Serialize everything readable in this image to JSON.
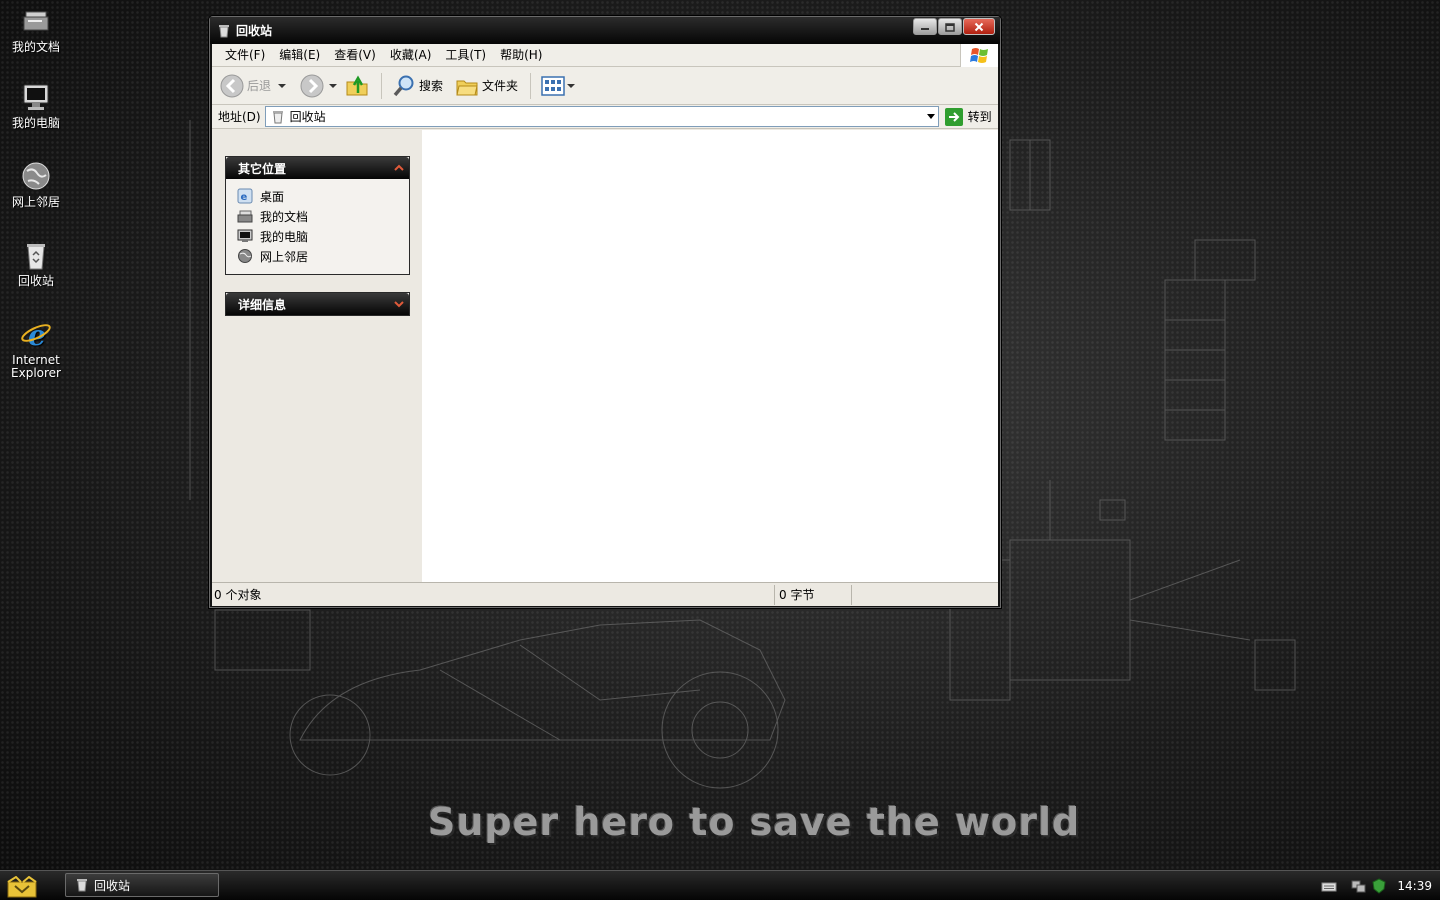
{
  "desktop": {
    "icons": [
      {
        "label": "我的文档",
        "icon": "my-documents-icon"
      },
      {
        "label": "我的电脑",
        "icon": "computer-icon"
      },
      {
        "label": "网上邻居",
        "icon": "network-globe-icon"
      },
      {
        "label": "回收站",
        "icon": "recycle-bin-icon"
      },
      {
        "label": "Internet Explorer",
        "icon": "internet-explorer-icon"
      }
    ],
    "wallpaper_text": "Super hero to save the world"
  },
  "window": {
    "title": "回收站",
    "menu": [
      "文件(F)",
      "编辑(E)",
      "查看(V)",
      "收藏(A)",
      "工具(T)",
      "帮助(H)"
    ],
    "toolbar": {
      "back": "后退",
      "search": "搜索",
      "folders": "文件夹"
    },
    "address": {
      "label": "地址(D)",
      "value": "回收站",
      "go": "转到"
    },
    "taskpane": {
      "other_places": {
        "title": "其它位置",
        "links": [
          "桌面",
          "我的文档",
          "我的电脑",
          "网上邻居"
        ]
      },
      "details": {
        "title": "详细信息"
      }
    },
    "status": {
      "objects": "0 个对象",
      "size": "0 字节"
    }
  },
  "taskbar": {
    "task_label": "回收站",
    "clock": "14:39"
  },
  "colors": {
    "titlebar": "#141414",
    "menubar": "#f0eee8",
    "taskpane_header": "#050505",
    "go_button": "#2f9e2f"
  }
}
